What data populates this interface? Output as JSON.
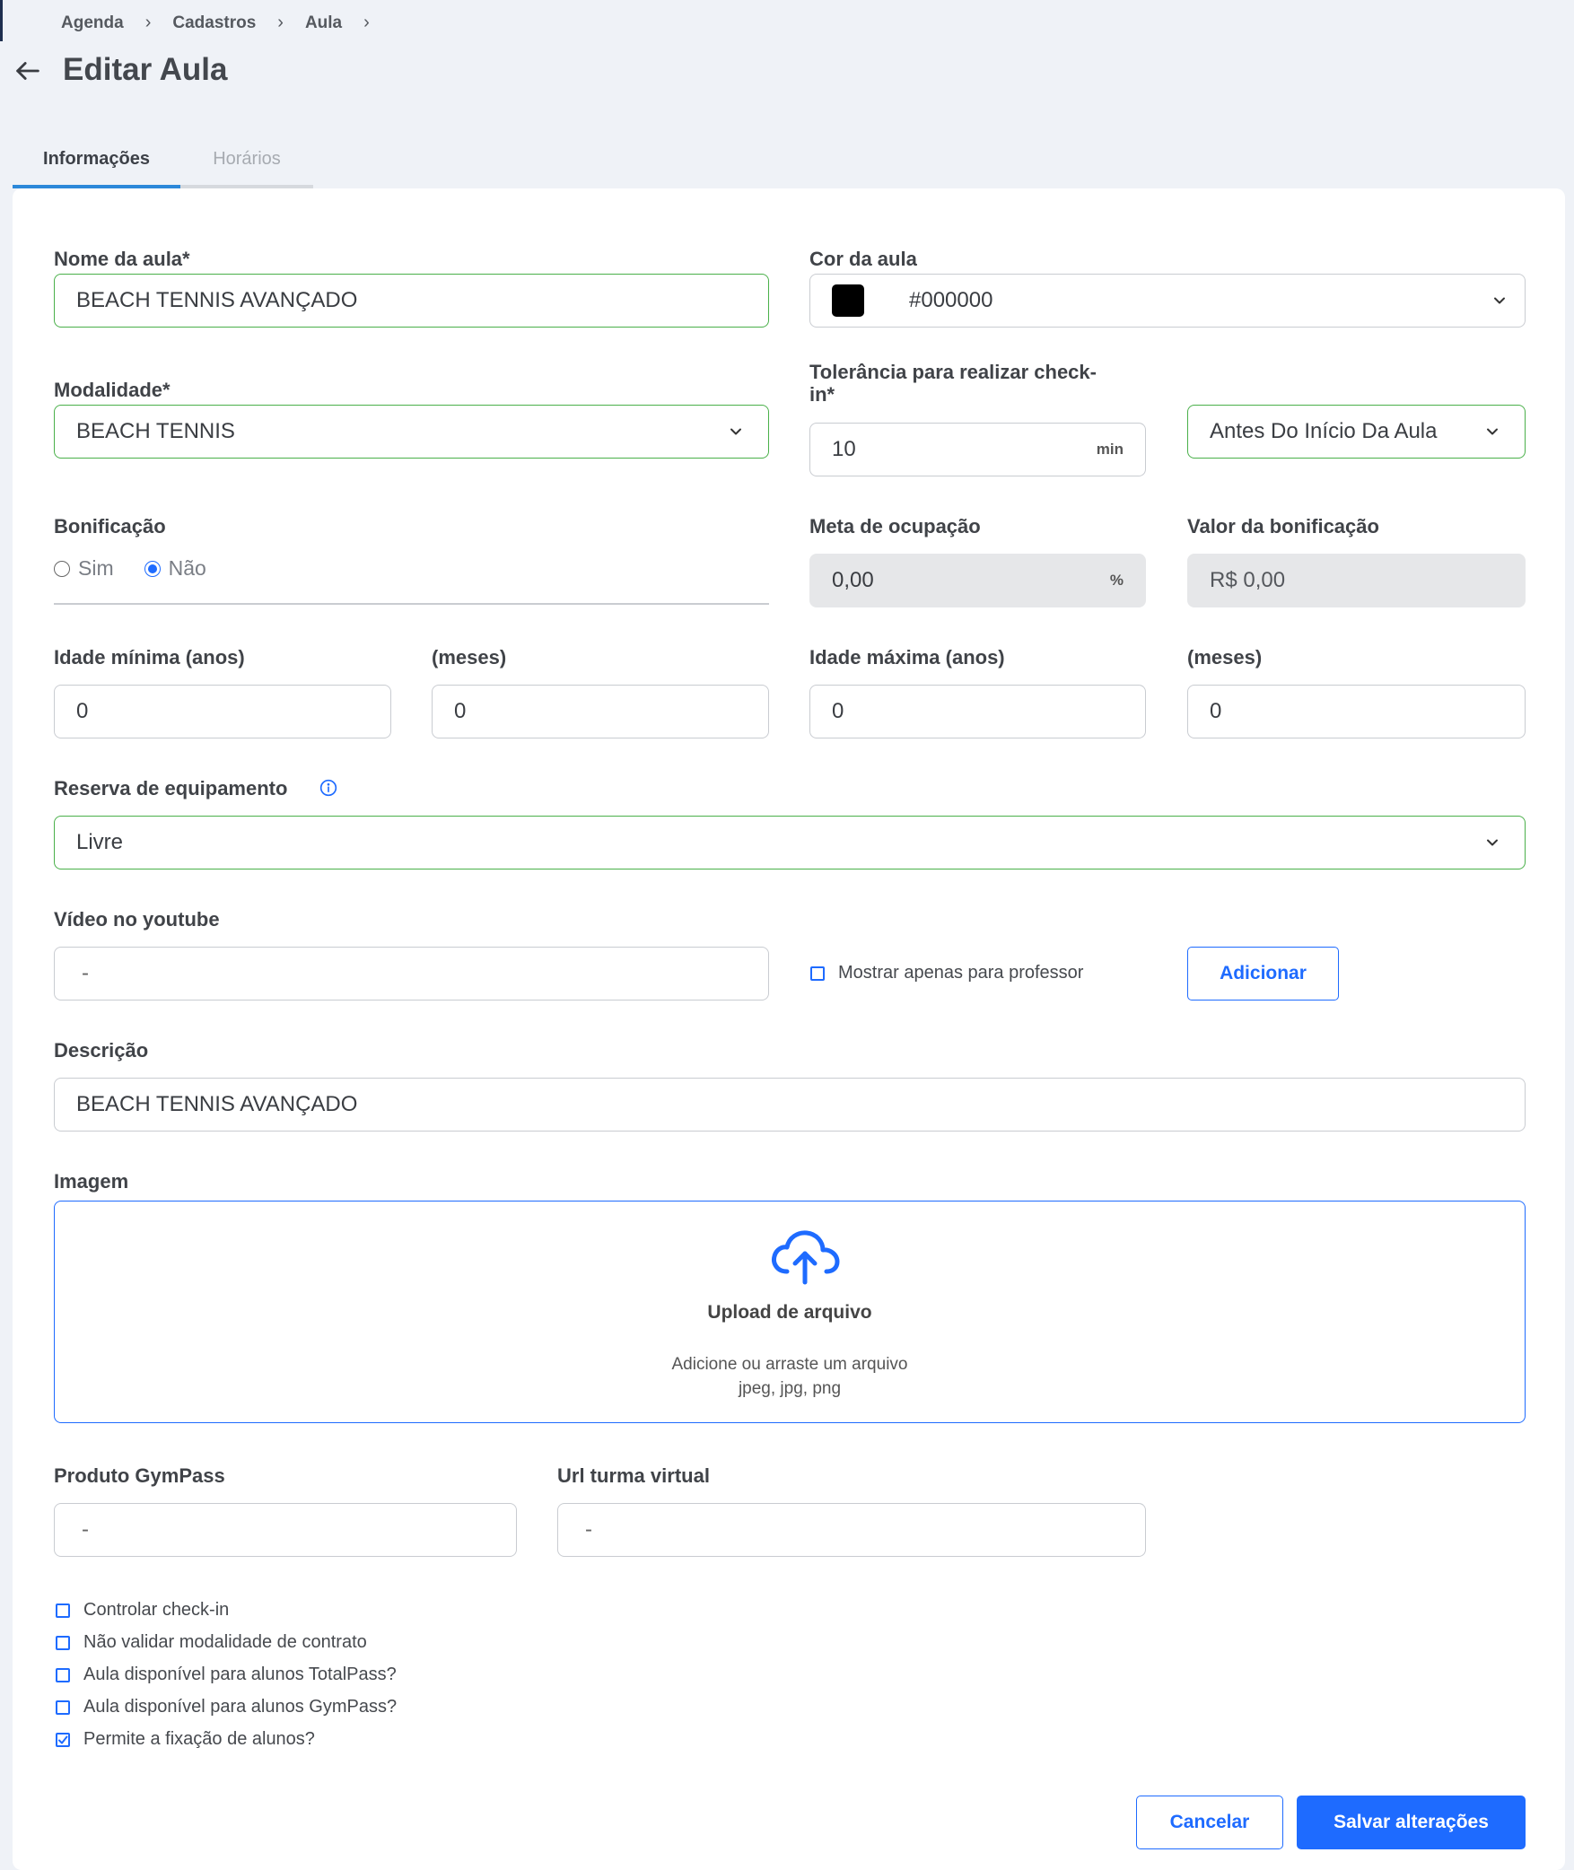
{
  "breadcrumb": [
    "Agenda",
    "Cadastros",
    "Aula"
  ],
  "page_title": "Editar Aula",
  "tabs": [
    "Informações",
    "Horários"
  ],
  "form": {
    "nome_label": "Nome da aula*",
    "nome_value": "BEACH TENNIS AVANÇADO",
    "cor_label": "Cor da aula",
    "cor_value": "#000000",
    "modalidade_label": "Modalidade*",
    "modalidade_value": "BEACH TENNIS",
    "tolerancia_label_1": "Tolerância para realizar check-",
    "tolerancia_label_2": "in*",
    "tolerancia_value": "10",
    "tolerancia_suffix": "min",
    "tolerancia_select": "Antes Do Início Da Aula",
    "bonificacao_label": "Bonificação",
    "bonificacao_opt_sim": "Sim",
    "bonificacao_opt_nao": "Não",
    "meta_label": "Meta de ocupação",
    "meta_value": "0,00",
    "meta_suffix": "%",
    "valor_label": "Valor da bonificação",
    "valor_value": "R$ 0,00",
    "idade_min_label": "Idade mínima (anos)",
    "idade_min_meses_label": "(meses)",
    "idade_max_label": "Idade máxima (anos)",
    "idade_max_meses_label": "(meses)",
    "idade_min_value": "0",
    "idade_min_meses_value": "0",
    "idade_max_value": "0",
    "idade_max_meses_value": "0",
    "reserva_label": "Reserva de equipamento",
    "reserva_value": "Livre",
    "video_label": "Vídeo no youtube",
    "video_value": "-",
    "mostrar_professor_label": "Mostrar apenas para professor",
    "adicionar_label": "Adicionar",
    "descricao_label": "Descrição",
    "descricao_value": "BEACH TENNIS AVANÇADO",
    "imagem_label": "Imagem",
    "upload_title": "Upload de arquivo",
    "upload_sub_1": "Adicione ou arraste um arquivo",
    "upload_sub_2": "jpeg, jpg, png",
    "gympass_label": "Produto GymPass",
    "gympass_value": "-",
    "url_label": "Url turma virtual",
    "url_value": "-"
  },
  "checkboxes": [
    {
      "label": "Controlar check-in",
      "checked": false
    },
    {
      "label": "Não validar modalidade de contrato",
      "checked": false
    },
    {
      "label": "Aula disponível para alunos TotalPass?",
      "checked": false
    },
    {
      "label": "Aula disponível para alunos GymPass?",
      "checked": false
    },
    {
      "label": "Permite a fixação de alunos?",
      "checked": true
    }
  ],
  "buttons": {
    "cancelar": "Cancelar",
    "salvar": "Salvar alterações"
  },
  "colors": {
    "primary": "#1e6bff",
    "valid_border": "#4ab04a",
    "tab_active": "#2c88d9",
    "swatch": "#000000"
  }
}
